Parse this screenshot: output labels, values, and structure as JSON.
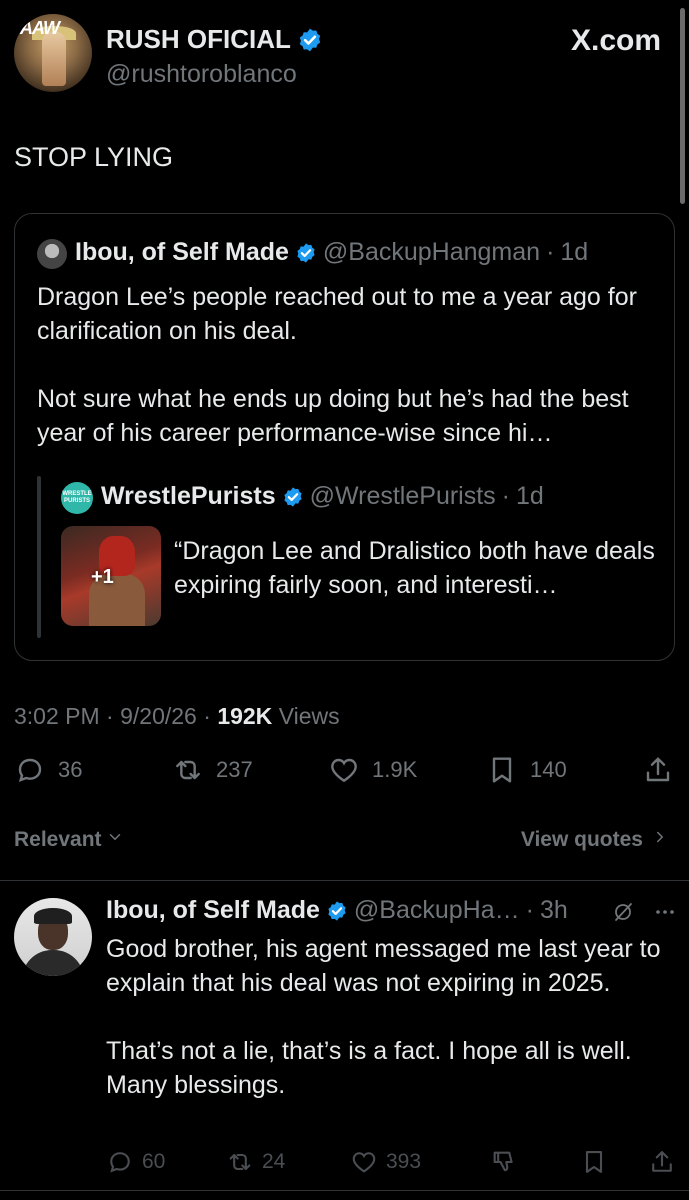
{
  "header": {
    "display_name": "RUSH OFICIAL",
    "handle": "@rushtoroblanco",
    "site_label": "X.com",
    "avatar_logo": "AAW"
  },
  "tweet": {
    "text": "STOP LYING",
    "timestamp_time": "3:02 PM",
    "timestamp_date": "9/20/26",
    "views_count": "192K",
    "views_label": "Views",
    "stats": {
      "replies": "36",
      "reposts": "237",
      "likes": "1.9K",
      "bookmarks": "140"
    }
  },
  "quoted": {
    "display_name": "Ibou, of Self Made",
    "handle": "@BackupHangman",
    "age": "1d",
    "paragraph1": "Dragon Lee’s people reached out to me a year ago for clarification on his deal.",
    "paragraph2": "Not sure what he ends up doing but he’s had the best year of his career performance-wise since hi…",
    "nested": {
      "display_name": "WrestlePurists",
      "handle": "@WrestlePurists",
      "age": "1d",
      "avatar_text": "WRESTLE PURISTS",
      "media_badge": "+1",
      "text": "“Dragon Lee and Dralistico both have deals expiring fairly soon, and interesti…"
    }
  },
  "sort": {
    "relevant_label": "Relevant",
    "view_quotes_label": "View quotes"
  },
  "reply": {
    "display_name": "Ibou, of Self Made",
    "handle": "@BackupHa…",
    "age": "3h",
    "paragraph1": "Good brother, his agent messaged me last year to explain that his deal was not expiring in 2025.",
    "paragraph2": "That’s not a lie, that’s is a fact. I hope all is well. Many blessings.",
    "stats": {
      "replies": "60",
      "reposts": "24",
      "likes": "393"
    }
  },
  "icons": {
    "verified": "verified-badge-icon",
    "reply": "reply-icon",
    "repost": "repost-icon",
    "like": "like-icon",
    "bookmark": "bookmark-icon",
    "share": "share-icon",
    "grok": "grok-icon",
    "more": "more-icon",
    "downvote": "downvote-icon"
  },
  "colors": {
    "background": "#000000",
    "text": "#e7e9ea",
    "muted": "#71767b",
    "verified": "#1d9bf0",
    "border": "#2f3336"
  }
}
